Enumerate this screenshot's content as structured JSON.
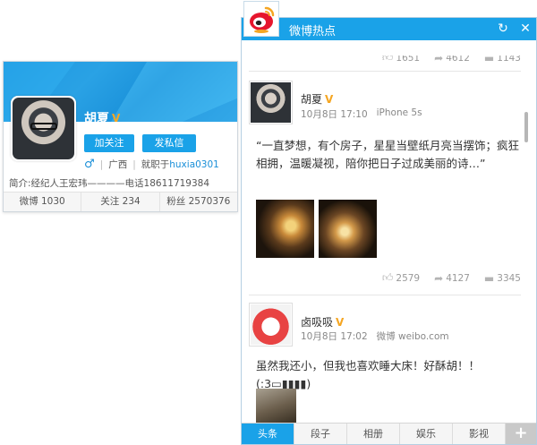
{
  "profile": {
    "name": "胡夏",
    "verified_badge": "V",
    "follow_label": "加关注",
    "message_label": "发私信",
    "gender_symbol": "♂",
    "location": "广西",
    "employer_prefix": "就职于",
    "employer": "huxia0301",
    "bio": "简介:经纪人王宏玮————电话18611719384",
    "stats": {
      "weibo": "微博 1030",
      "following": "关注 234",
      "followers": "粉丝 2570376"
    }
  },
  "panel": {
    "title": "微博热点",
    "refresh_icon": "refresh-icon",
    "close_icon": "close-icon"
  },
  "feed": {
    "top_actions": {
      "likes": "1651",
      "reposts": "4612",
      "comments": "1143"
    },
    "posts": [
      {
        "author": "胡夏",
        "verified": "V",
        "time": "10月8日 17:10",
        "source": "iPhone 5s",
        "text": "“一直梦想，有个房子，星星当壁纸月亮当摆饰；疯狂相拥，温暖凝视，陪你把日子过成美丽的诗…”",
        "likes": "2579",
        "reposts": "4127",
        "comments": "3345"
      },
      {
        "author": "卤吸吸",
        "verified": "V",
        "time": "10月8日 17:02",
        "source": "微博 weibo.com",
        "text": "虽然我还小，但我也喜欢睡大床！好酥胡！！(:3▭▮▮▮▮)"
      }
    ]
  },
  "tabs": [
    "头条",
    "段子",
    "相册",
    "娱乐",
    "影视"
  ],
  "tab_add": "+",
  "colors": {
    "accent": "#1aa2e8",
    "verified": "#f5a623"
  }
}
